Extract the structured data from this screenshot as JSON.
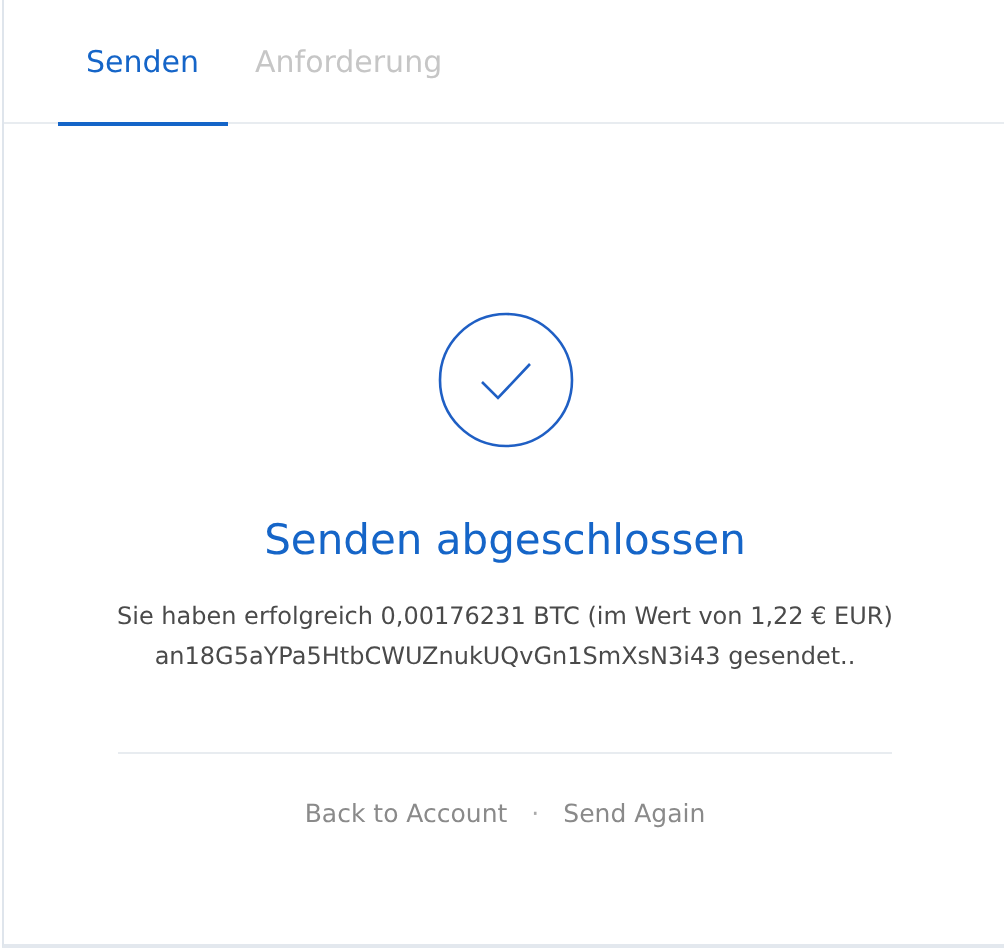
{
  "tabs": [
    {
      "label": "Senden",
      "selected": true
    },
    {
      "label": "Anforderung",
      "selected": false
    }
  ],
  "success": {
    "title": "Senden abgeschlossen",
    "message": "Sie haben erfolgreich 0,00176231 BTC (im Wert von 1,22 € EUR) an18G5aYPa5HtbCWUZnukUQvGn1SmXsN3i43 gesendet.."
  },
  "footer": {
    "links": [
      "Back to Account",
      "Send Again"
    ],
    "separator": "·"
  }
}
